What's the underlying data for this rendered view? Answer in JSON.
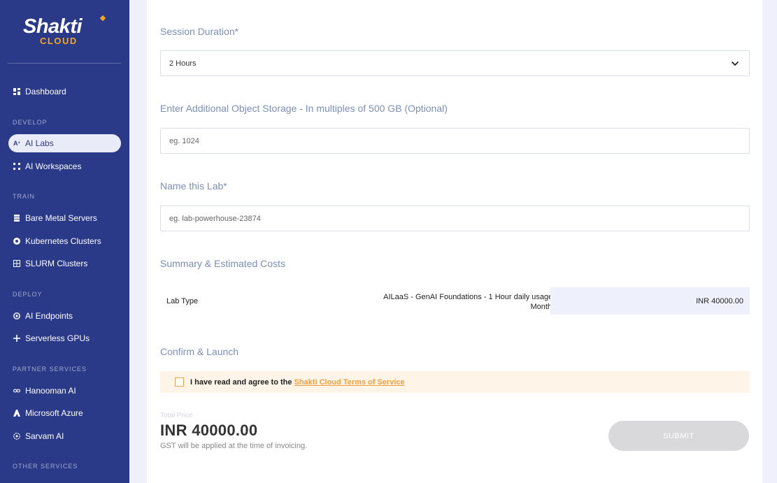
{
  "brand": {
    "name": "Shakti",
    "sub": "CLOUD"
  },
  "sidebar": {
    "dashboard": {
      "label": "Dashboard",
      "icon": "grid-icon"
    },
    "develop": {
      "title": "DEVELOP",
      "items": [
        {
          "label": "AI Labs",
          "icon": "ai-labs-icon",
          "active": true
        },
        {
          "label": "AI Workspaces",
          "icon": "workspace-icon"
        }
      ]
    },
    "train": {
      "title": "TRAIN",
      "items": [
        {
          "label": "Bare Metal Servers",
          "icon": "server-icon"
        },
        {
          "label": "Kubernetes Clusters",
          "icon": "kubernetes-icon"
        },
        {
          "label": "SLURM Clusters",
          "icon": "cluster-icon"
        }
      ]
    },
    "deploy": {
      "title": "DEPLOY",
      "items": [
        {
          "label": "AI Endpoints",
          "icon": "endpoint-icon"
        },
        {
          "label": "Serverless GPUs",
          "icon": "serverless-icon"
        }
      ]
    },
    "partner": {
      "title": "PARTNER SERVICES",
      "items": [
        {
          "label": "Hanooman AI",
          "icon": "infinity-icon"
        },
        {
          "label": "Microsoft Azure",
          "icon": "azure-icon"
        },
        {
          "label": "Sarvam AI",
          "icon": "sarvam-icon"
        }
      ]
    },
    "other": {
      "title": "OTHER SERVICES"
    }
  },
  "form": {
    "session": {
      "label": "Session Duration*",
      "value": "2 Hours"
    },
    "storage": {
      "label": "Enter Additional Object Storage - In multiples of 500 GB (Optional)",
      "placeholder": "eg. 1024"
    },
    "name": {
      "label": "Name this Lab*",
      "placeholder": "eg. lab-powerhouse-23874"
    }
  },
  "summary": {
    "title": "Summary & Estimated Costs",
    "type_label": "Lab Type",
    "desc_line1": "AILaaS - GenAI Foundations - 1 Hour daily usage -",
    "desc_line2": "Monthly",
    "price": "INR 40000.00"
  },
  "confirm": {
    "title": "Confirm & Launch",
    "agree_text": "I have read and agree to the",
    "agree_link": "Shakti Cloud Terms of Service"
  },
  "total": {
    "label": "Total Price",
    "value": "INR 40000.00",
    "note": "GST will be applied at the time of invoicing."
  },
  "submit_label": "SUBMIT",
  "colors": {
    "sidebar": "#2b3a88",
    "accent": "#f5a623",
    "label": "#7b8fb8"
  }
}
